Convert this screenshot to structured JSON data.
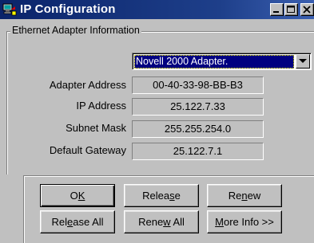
{
  "window": {
    "title": "IP Configuration",
    "icon": "network-computer-icon"
  },
  "titlebar_buttons": {
    "minimize_icon": "minimize-icon",
    "maximize_icon": "maximize-icon",
    "close_icon": "close-icon"
  },
  "group": {
    "label": "Ethernet  Adapter Information"
  },
  "adapter": {
    "selected": "Novell 2000 Adapter."
  },
  "fields": [
    {
      "label": "Adapter Address",
      "value": "00-40-33-98-BB-B3"
    },
    {
      "label": "IP Address",
      "value": "25.122.7.33"
    },
    {
      "label": "Subnet Mask",
      "value": "255.255.254.0"
    },
    {
      "label": "Default Gateway",
      "value": "25.122.7.1"
    }
  ],
  "buttons": {
    "ok": {
      "pre": "O",
      "ul": "K",
      "post": ""
    },
    "release": {
      "pre": "Relea",
      "ul": "s",
      "post": "e"
    },
    "renew": {
      "pre": "Re",
      "ul": "n",
      "post": "ew"
    },
    "release_all": {
      "pre": "Rel",
      "ul": "e",
      "post": "ase All"
    },
    "renew_all": {
      "pre": "Rene",
      "ul": "w",
      "post": " All"
    },
    "more_info": {
      "pre": "",
      "ul": "M",
      "post": "ore Info >>"
    }
  },
  "colors": {
    "titlebar": "#0a246a",
    "selection": "#000080",
    "face": "#c0c0c0"
  }
}
